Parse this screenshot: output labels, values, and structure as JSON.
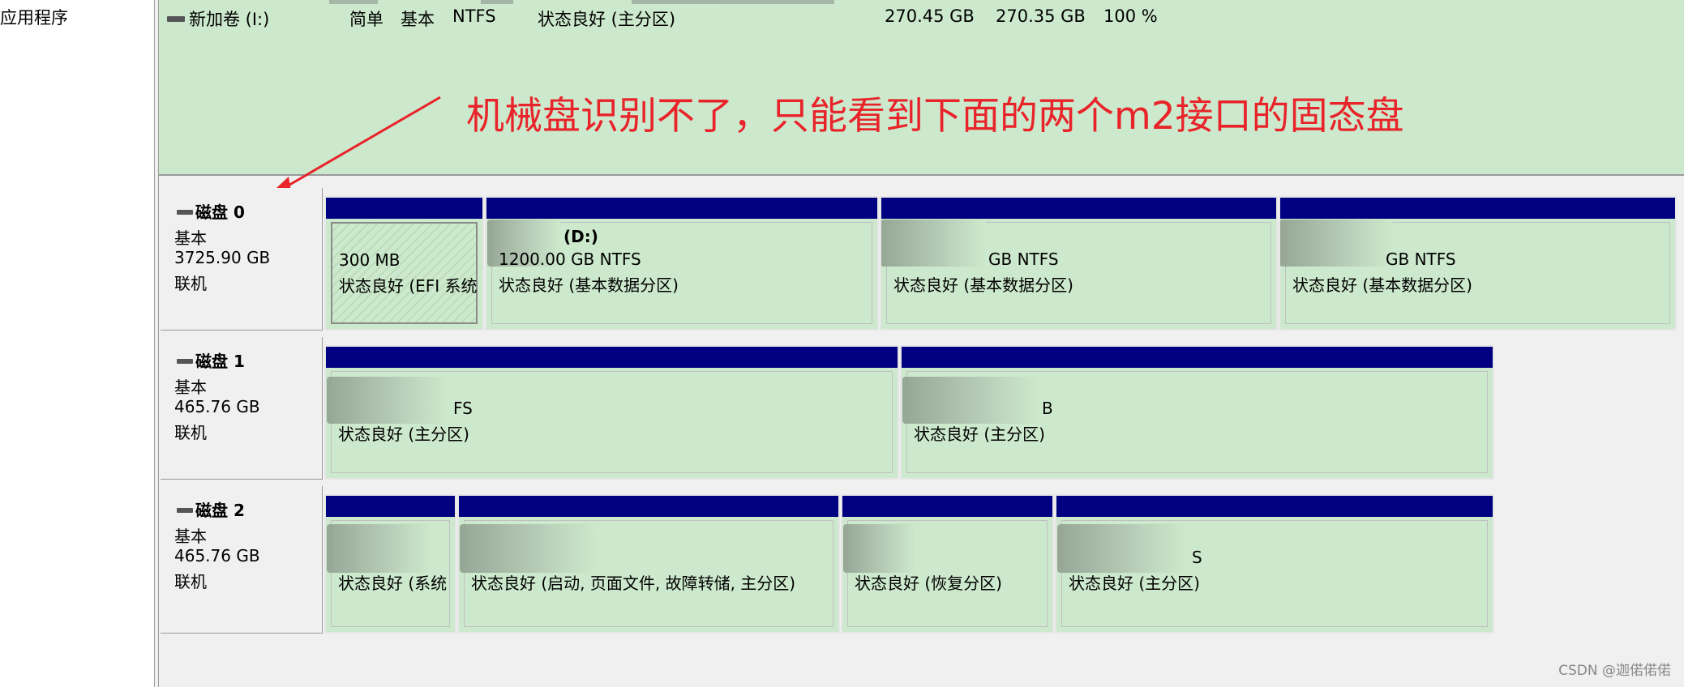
{
  "left_pane": {
    "item": "应用程序"
  },
  "volume_list": {
    "row": {
      "name": "新加卷 (I:)",
      "layout": "简单",
      "type": "基本",
      "fs": "NTFS",
      "status": "状态良好 (主分区)",
      "capacity": "270.45 GB",
      "free": "270.35 GB",
      "percent_free": "100 %"
    }
  },
  "annotation": {
    "text": "机械盘识别不了，只能看到下面的两个m2接口的固态盘",
    "color": "#e8242a"
  },
  "disks": [
    {
      "name": "磁盘 0",
      "type": "基本",
      "size": "3725.90 GB",
      "status": "联机",
      "partitions": [
        {
          "label": "",
          "size": "300 MB",
          "status": "状态良好 (EFI 系统"
        },
        {
          "label": "(D:)",
          "size": "1200.00 GB NTFS",
          "status": "状态良好 (基本数据分区)"
        },
        {
          "label": "",
          "size": "GB NTFS",
          "status": "状态良好 (基本数据分区)"
        },
        {
          "label": "",
          "size": "GB NTFS",
          "status": "状态良好 (基本数据分区)"
        }
      ]
    },
    {
      "name": "磁盘 1",
      "type": "基本",
      "size": "465.76 GB",
      "status": "联机",
      "partitions": [
        {
          "label": "",
          "size": "FS",
          "status": "状态良好 (主分区)"
        },
        {
          "label": "",
          "size": "B",
          "status": "状态良好 (主分区)"
        }
      ]
    },
    {
      "name": "磁盘 2",
      "type": "基本",
      "size": "465.76 GB",
      "status": "联机",
      "partitions": [
        {
          "label": "",
          "size": "",
          "status": "状态良好 (系统"
        },
        {
          "label": "",
          "size": "",
          "status": "状态良好 (启动, 页面文件, 故障转储, 主分区)"
        },
        {
          "label": "",
          "size": "",
          "status": "状态良好 (恢复分区)"
        },
        {
          "label": "",
          "size": "S",
          "status": "状态良好 (主分区)"
        }
      ]
    }
  ],
  "watermark": "CSDN @迦偌偌偌",
  "colors": {
    "partition_header": "#000080",
    "partition_fill": "#cde9cd"
  }
}
